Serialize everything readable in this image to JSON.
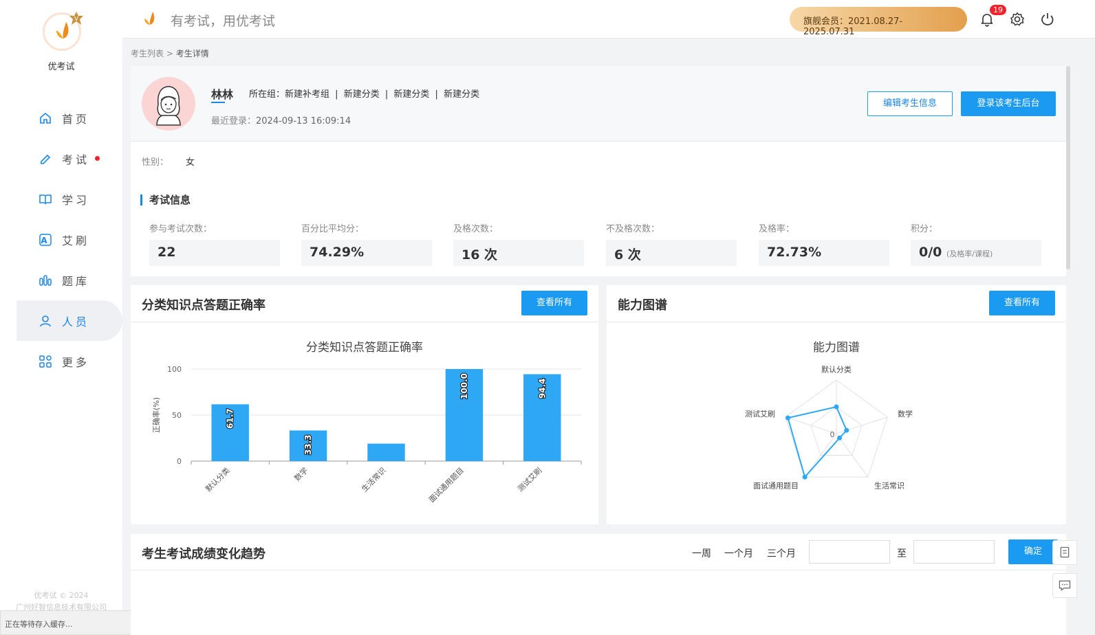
{
  "app": {
    "logo_text": "优考试",
    "slogan": "有考试，用优考试",
    "footer_line1": "优考试 © 2024",
    "footer_line2": "广州好智信息技术有限公司",
    "status_text": "正在等待存入缓存..."
  },
  "sidebar": {
    "items": [
      {
        "label": "首页",
        "icon": "home-icon"
      },
      {
        "label": "考试",
        "icon": "exam-icon"
      },
      {
        "label": "学习",
        "icon": "book-icon"
      },
      {
        "label": "艾刷",
        "icon": "letter-a-icon"
      },
      {
        "label": "题库",
        "icon": "bar-icon"
      },
      {
        "label": "人员",
        "icon": "user-icon"
      },
      {
        "label": "更多",
        "icon": "apps-icon"
      }
    ]
  },
  "header": {
    "vip_text": "旗舰会员：2021.08.27-2025.07.31",
    "notification_count": "19"
  },
  "breadcrumb": {
    "parent": "考生列表",
    "sep": " > ",
    "current": "考生详情"
  },
  "profile": {
    "name": "林林",
    "groups": [
      "所在组：新建补考组",
      "|",
      "新建分类",
      "|",
      "新建分类",
      "|",
      "新建分类"
    ],
    "last_login_label": "最近登录：",
    "last_login": "2024-09-13 16:09:14",
    "edit_button": "编辑考生信息",
    "login_button": "登录该考生后台",
    "gender_label": "性别：",
    "gender": "女"
  },
  "exam_info": {
    "title": "考试信息",
    "stats": [
      {
        "label": "参与考试次数：",
        "value": "22",
        "note": ""
      },
      {
        "label": "百分比平均分：",
        "value": "74.29%",
        "note": ""
      },
      {
        "label": "及格次数：",
        "value": "16 次",
        "note": ""
      },
      {
        "label": "不及格次数：",
        "value": "6 次",
        "note": ""
      },
      {
        "label": "及格率：",
        "value": "72.73%",
        "note": ""
      },
      {
        "label": "积分：",
        "value": "0/0",
        "note": "(及格率/课程)"
      }
    ]
  },
  "accuracy_card": {
    "title": "分类知识点答题正确率",
    "button": "查看所有"
  },
  "ability_card": {
    "title": "能力图谱",
    "button": "查看所有"
  },
  "trend": {
    "title": "考生考试成绩变化趋势",
    "ranges": [
      "一周",
      "一个月",
      "三个月"
    ],
    "to": "至",
    "confirm": "确定"
  },
  "chart_data": [
    {
      "type": "bar",
      "title": "分类知识点答题正确率",
      "ylabel": "正确率(%)",
      "xlabel": "",
      "ylim": [
        0,
        100
      ],
      "yticks": [
        0,
        50,
        100
      ],
      "categories": [
        "默认分类",
        "数学",
        "生活常识",
        "面试通用题目",
        "测试艾刷"
      ],
      "values": [
        61.7,
        33.3,
        19,
        100.0,
        94.4
      ],
      "labels": [
        "61.7",
        "33.3",
        "",
        "100.0",
        "94.4"
      ],
      "color": "#2ea7f5",
      "grid": true
    },
    {
      "type": "radar",
      "title": "能力图谱",
      "indicators": [
        "默认分类",
        "数学",
        "生活常识",
        "面试通用题目",
        "测试艾刷"
      ],
      "values": [
        0.5,
        0.2,
        0.1,
        1.0,
        0.95
      ],
      "center_label": "0",
      "color": "#2ea7f5"
    }
  ]
}
